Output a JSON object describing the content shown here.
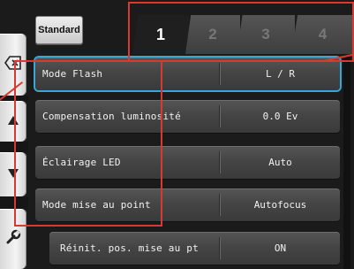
{
  "top_button": {
    "label": "Standard"
  },
  "tabs": [
    {
      "label": "1",
      "active": true
    },
    {
      "label": "2",
      "active": false
    },
    {
      "label": "3",
      "active": false
    },
    {
      "label": "4",
      "active": false
    }
  ],
  "rail": [
    "backspace-icon",
    "arrow-up-icon",
    "arrow-down-icon",
    "wrench-icon"
  ],
  "menu": [
    {
      "label": "Mode Flash",
      "value": "L / R",
      "selected": true
    },
    {
      "label": "Compensation luminosité",
      "value": "0.0 Ev",
      "selected": false
    },
    {
      "label": "Éclairage LED",
      "value": "Auto",
      "selected": false
    },
    {
      "label": "Mode mise au point",
      "value": "Autofocus",
      "selected": false
    },
    {
      "label": "Réinit. pos. mise au pt",
      "value": "ON",
      "selected": false
    }
  ],
  "colors": {
    "selection": "#3aa6d6",
    "annotation": "#d93a2f",
    "background": "#1b1b1b"
  }
}
